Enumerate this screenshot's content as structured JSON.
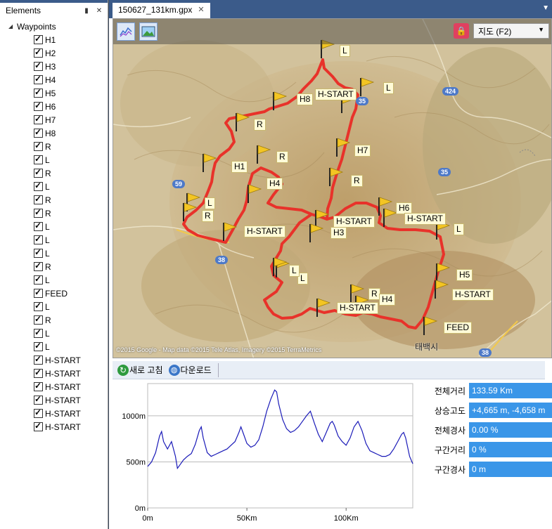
{
  "elements_panel": {
    "title": "Elements",
    "pin_icon": "pin-icon",
    "close_icon": "close-icon",
    "root_label": "Waypoints",
    "items": [
      "H1",
      "H2",
      "H3",
      "H4",
      "H5",
      "H6",
      "H7",
      "H8",
      "R",
      "L",
      "R",
      "L",
      "R",
      "R",
      "L",
      "L",
      "L",
      "R",
      "L",
      "FEED",
      "L",
      "R",
      "L",
      "L",
      "H-START",
      "H-START",
      "H-START",
      "H-START",
      "H-START",
      "H-START"
    ]
  },
  "doc_tab": {
    "title": "150627_131km.gpx"
  },
  "map": {
    "type_select": "지도 (F2)",
    "copyright": "©2015 Google - Map data ©2015 Tele Atlas, Imagery ©2015 TerraMetrics",
    "road_numbers": [
      "424",
      "35",
      "59",
      "38",
      "38",
      "35"
    ],
    "place_name": "태백시",
    "waypoint_tags": [
      "L",
      "L",
      "H-START",
      "H8",
      "R",
      "R",
      "H7",
      "H1",
      "H4",
      "R",
      "H6",
      "H-START",
      "L",
      "L",
      "R",
      "H-START",
      "H-START",
      "H3",
      "L",
      "H5",
      "H-START",
      "R",
      "H-START",
      "H4",
      "FEED",
      "L"
    ],
    "route_color": "#e8322a"
  },
  "profile_toolbar": {
    "refresh_label": "새로 고침",
    "download_label": "다운로드"
  },
  "chart_data": {
    "type": "line",
    "title": "",
    "xlabel": "",
    "ylabel": "",
    "x_ticks": [
      "0m",
      "50Km",
      "100Km"
    ],
    "y_ticks": [
      "0m",
      "500m",
      "1000m"
    ],
    "xlim": [
      0,
      133.59
    ],
    "ylim": [
      0,
      1350
    ],
    "grid": true,
    "series": [
      {
        "x": [
          0,
          2,
          4,
          6,
          7,
          8,
          10,
          12,
          14,
          15,
          16,
          18,
          20,
          22,
          24,
          26,
          27,
          28,
          30,
          32,
          34,
          36,
          38,
          40,
          42,
          44,
          46,
          47,
          48,
          50,
          52,
          54,
          56,
          58,
          60,
          62,
          64,
          65,
          66,
          68,
          70,
          72,
          74,
          76,
          78,
          80,
          82,
          84,
          86,
          88,
          90,
          92,
          93,
          94,
          96,
          98,
          100,
          102,
          104,
          106,
          108,
          110,
          112,
          114,
          116,
          118,
          120,
          122,
          124,
          126,
          128,
          129,
          130,
          132,
          133.59
        ],
        "values": [
          450,
          500,
          600,
          780,
          830,
          720,
          640,
          720,
          560,
          430,
          460,
          520,
          560,
          590,
          690,
          840,
          880,
          760,
          600,
          560,
          580,
          600,
          620,
          640,
          680,
          720,
          820,
          880,
          820,
          700,
          660,
          680,
          740,
          880,
          1050,
          1180,
          1280,
          1260,
          1130,
          960,
          860,
          820,
          840,
          880,
          940,
          1000,
          1050,
          920,
          800,
          720,
          820,
          920,
          940,
          900,
          780,
          720,
          680,
          760,
          880,
          940,
          840,
          700,
          620,
          600,
          580,
          560,
          560,
          580,
          640,
          720,
          800,
          820,
          760,
          560,
          480
        ]
      }
    ]
  },
  "stats": [
    {
      "label": "전체거리",
      "value": "133.59 Km"
    },
    {
      "label": "상승고도",
      "value": "+4,665 m, -4,658 m"
    },
    {
      "label": "전체경사",
      "value": "0.00 %"
    },
    {
      "label": "구간거리",
      "value": "0 %"
    },
    {
      "label": "구간경사",
      "value": "0 m"
    }
  ]
}
